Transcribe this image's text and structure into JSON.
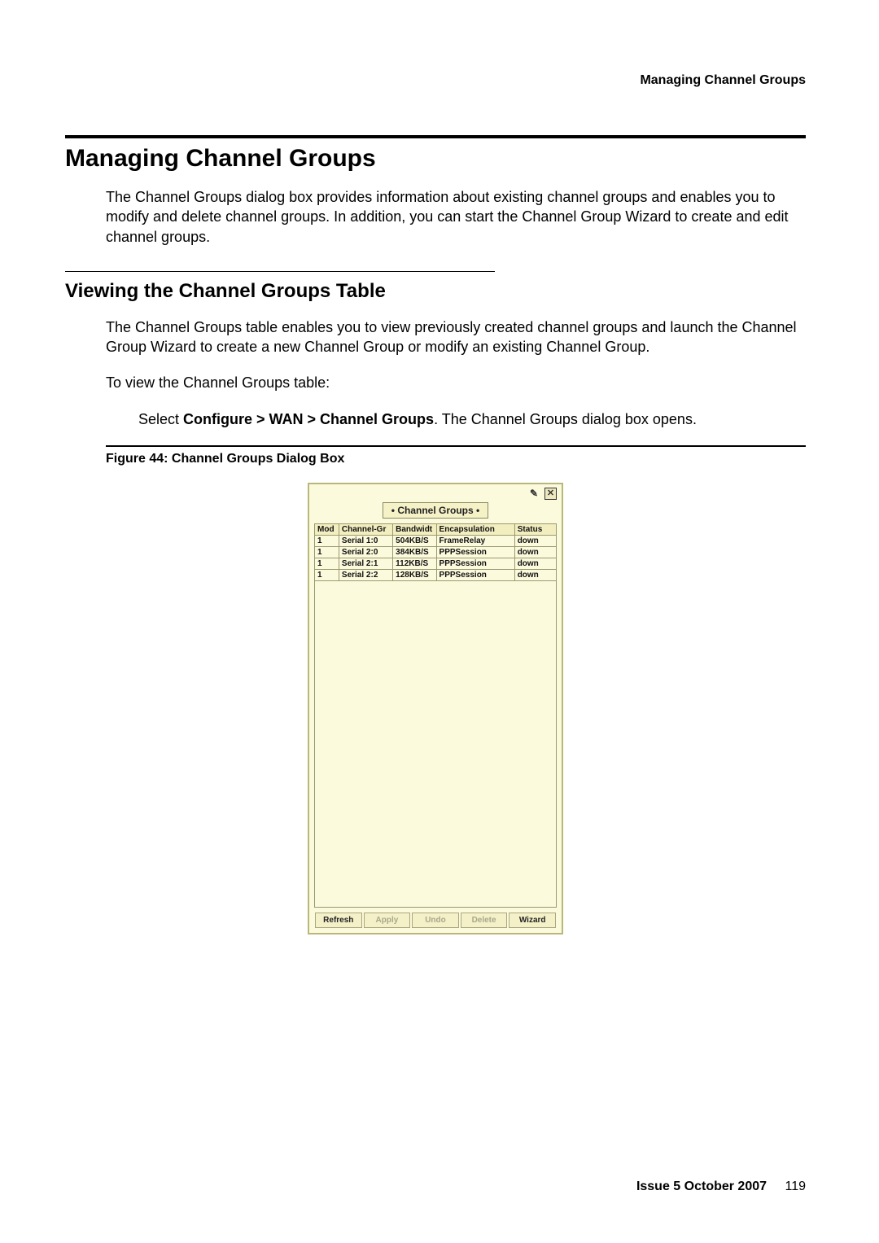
{
  "running_head": "Managing Channel Groups",
  "section_title": "Managing Channel Groups",
  "intro_paragraph": "The Channel Groups dialog box provides information about existing channel groups and enables you to modify and delete channel groups. In addition, you can start the Channel Group Wizard to create and edit channel groups.",
  "subsection_title": "Viewing the Channel Groups Table",
  "sub_para_1": "The Channel Groups table enables you to view previously created channel groups and launch the Channel Group Wizard to create a new Channel Group or modify an existing Channel Group.",
  "sub_para_2": "To view the Channel Groups table:",
  "step_prefix": "Select ",
  "step_bold": "Configure > WAN > Channel Groups",
  "step_suffix": ". The Channel Groups dialog box opens.",
  "figure_caption": "Figure 44: Channel Groups Dialog Box",
  "dialog": {
    "title": "• Channel Groups •",
    "columns": [
      "Mod",
      "Channel-Gr",
      "Bandwidt",
      "Encapsulation",
      "Status"
    ],
    "rows": [
      {
        "mod": "1",
        "cg": "Serial 1:0",
        "bw": "504KB/S",
        "enc": "FrameRelay",
        "st": "down"
      },
      {
        "mod": "1",
        "cg": "Serial 2:0",
        "bw": "384KB/S",
        "enc": "PPPSession",
        "st": "down"
      },
      {
        "mod": "1",
        "cg": "Serial 2:1",
        "bw": "112KB/S",
        "enc": "PPPSession",
        "st": "down"
      },
      {
        "mod": "1",
        "cg": "Serial 2:2",
        "bw": "128KB/S",
        "enc": "PPPSession",
        "st": "down"
      }
    ],
    "buttons": {
      "refresh": "Refresh",
      "apply": "Apply",
      "undo": "Undo",
      "delete": "Delete",
      "wizard": "Wizard"
    },
    "close_glyph": "✕",
    "pushpin_glyph": "✎"
  },
  "footer_issue": "Issue 5   October 2007",
  "footer_page": "119"
}
